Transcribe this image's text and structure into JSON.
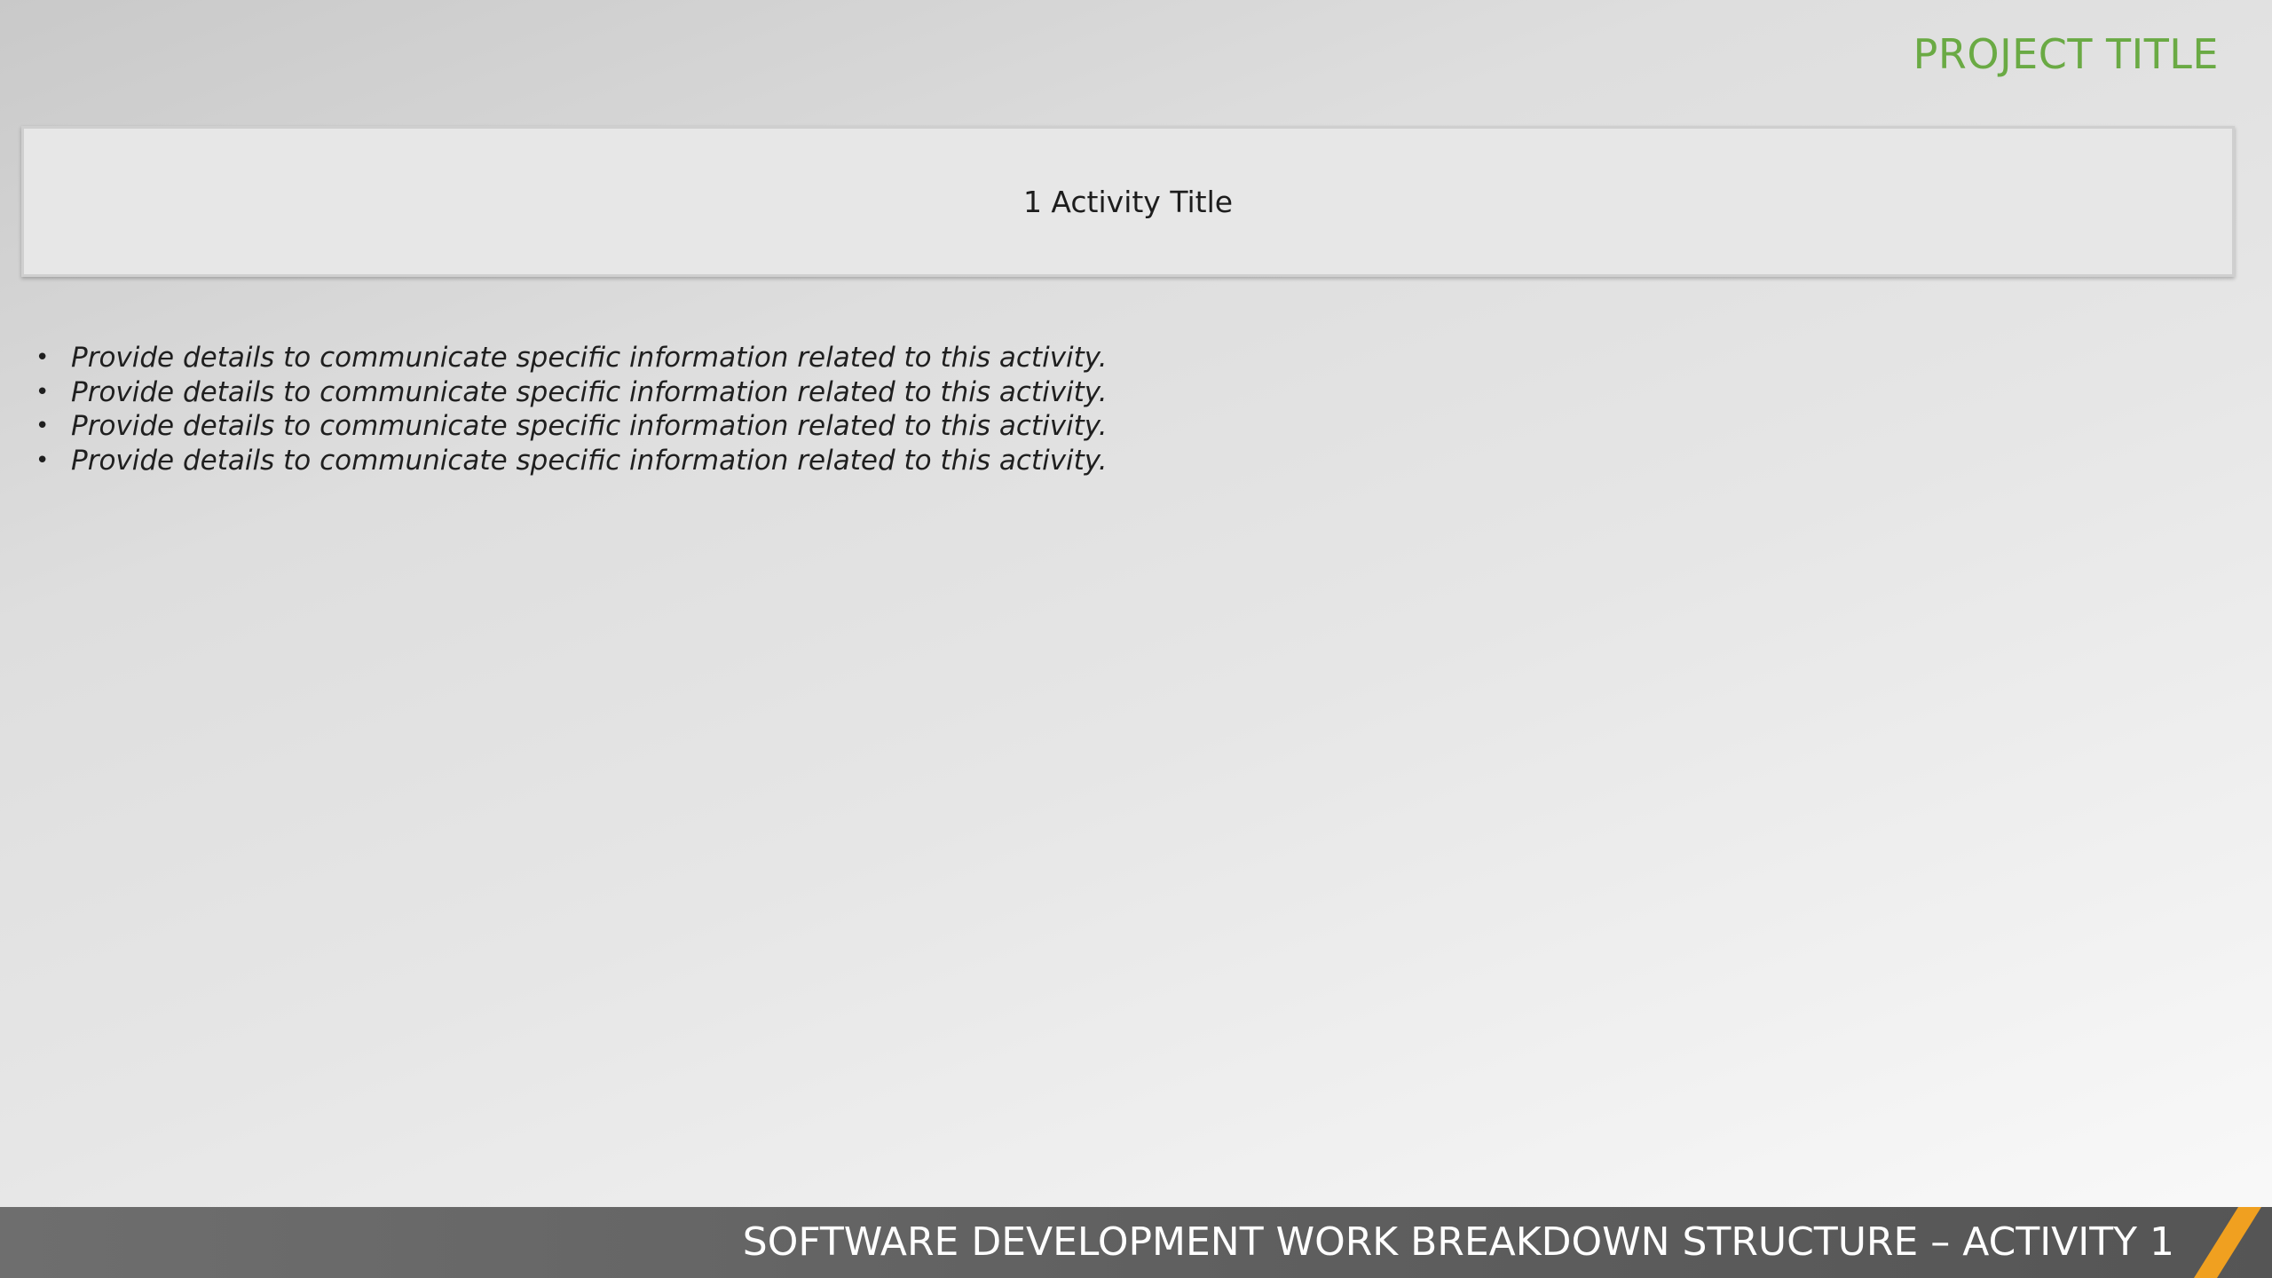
{
  "header": {
    "project_title": "PROJECT TITLE"
  },
  "activity": {
    "title": "1 Activity Title"
  },
  "details": {
    "bullets": [
      "Provide details to communicate specific information related to this activity.",
      "Provide details to communicate specific information related to this activity.",
      "Provide details to communicate specific information related to this activity.",
      "Provide details to communicate specific information related to this activity."
    ]
  },
  "footer": {
    "title": "SOFTWARE DEVELOPMENT WORK BREAKDOWN STRUCTURE – ACTIVITY 1"
  },
  "colors": {
    "accent_green": "#6aaa44",
    "accent_orange": "#f0a020",
    "footer_bar": "#606060"
  }
}
